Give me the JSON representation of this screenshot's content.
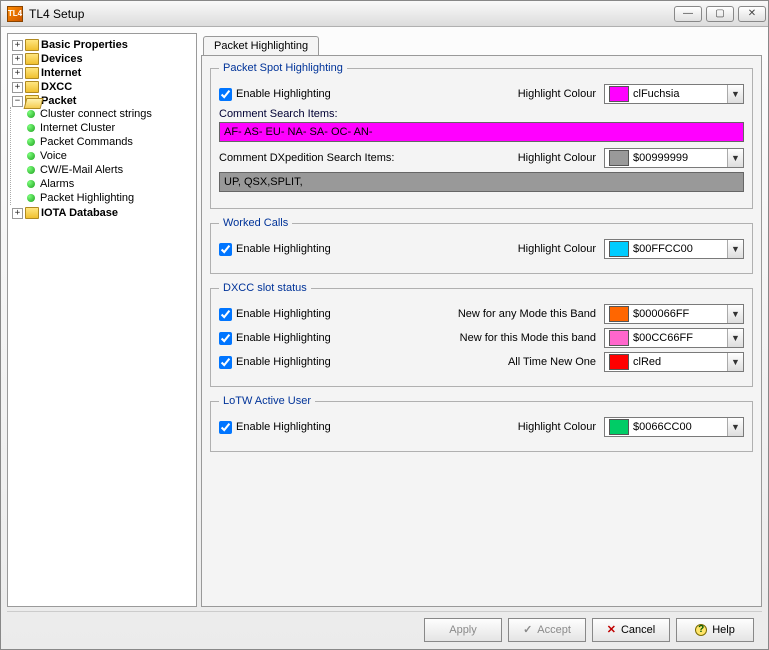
{
  "window": {
    "title": "TL4 Setup",
    "app_icon_text": "TL4"
  },
  "tree": {
    "basic": "Basic Properties",
    "devices": "Devices",
    "internet": "Internet",
    "dxcc": "DXCC",
    "packet": "Packet",
    "packet_children": [
      "Cluster connect strings",
      "Internet Cluster",
      "Packet Commands",
      "Voice",
      "CW/E-Mail Alerts",
      "Alarms",
      "Packet Highlighting"
    ],
    "iota": "IOTA Database"
  },
  "tab": {
    "label": "Packet Highlighting"
  },
  "spot": {
    "legend": "Packet Spot Highlighting",
    "enable": "Enable Highlighting",
    "hc_label": "Highlight Colour",
    "hc1_value": "clFuchsia",
    "hc1_color": "#ff00ff",
    "comment_label": "Comment Search Items:",
    "comment_value": "AF- AS- EU- NA- SA- OC- AN-",
    "dxp_label": "Comment DXpedition Search Items:",
    "hc2_value": "$00999999",
    "hc2_color": "#999999",
    "dxp_value": "UP, QSX,SPLIT,"
  },
  "worked": {
    "legend": "Worked Calls",
    "enable": "Enable Highlighting",
    "hc_label": "Highlight Colour",
    "value": "$00FFCC00",
    "color": "#00ccff"
  },
  "dxcc_slot": {
    "legend": "DXCC slot status",
    "enable": "Enable Highlighting",
    "row1_label": "New for any Mode this Band",
    "row1_value": "$000066FF",
    "row1_color": "#ff6600",
    "row2_label": "New for this Mode this band",
    "row2_value": "$00CC66FF",
    "row2_color": "#ff66cc",
    "row3_label": "All Time New One",
    "row3_value": "clRed",
    "row3_color": "#ff0000"
  },
  "lotw": {
    "legend": "LoTW Active User",
    "enable": "Enable Highlighting",
    "hc_label": "Highlight Colour",
    "value": "$0066CC00",
    "color": "#00cc66"
  },
  "buttons": {
    "apply": "Apply",
    "accept": "Accept",
    "cancel": "Cancel",
    "help": "Help"
  }
}
